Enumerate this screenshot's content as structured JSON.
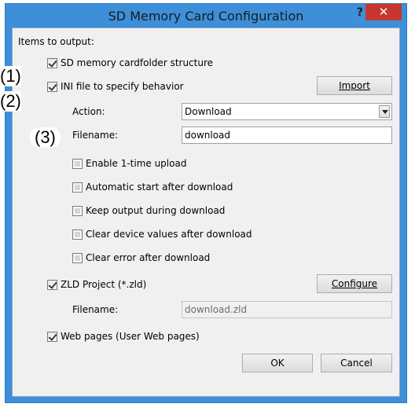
{
  "window": {
    "title": "SD Memory Card Configuration",
    "help": "?",
    "close": "✕"
  },
  "header": "Items to output:",
  "markers": {
    "m1": "(1)",
    "m2": "(2)",
    "m3": "(3)"
  },
  "items": {
    "sd_folder": {
      "label": "SD memory cardfolder structure",
      "checked": true
    },
    "ini_file": {
      "label": "INI file to specify behavior",
      "checked": true
    },
    "import_button": "Import",
    "action_label": "Action:",
    "action_value": "Download",
    "filename_label": "Filename:",
    "filename_value": "download",
    "options": [
      {
        "label": "Enable 1-time upload",
        "checked": false
      },
      {
        "label": "Automatic start after download",
        "checked": false
      },
      {
        "label": "Keep output during download",
        "checked": false
      },
      {
        "label": "Clear device values after download",
        "checked": false
      },
      {
        "label": "Clear error after download",
        "checked": false
      }
    ],
    "zld_project": {
      "label": "ZLD Project (*.zld)",
      "checked": true
    },
    "configure_button": "Configure",
    "zld_filename_label": "Filename:",
    "zld_filename_value": "download.zld",
    "web_pages": {
      "label": "Web pages (User Web pages)",
      "checked": true
    }
  },
  "footer": {
    "ok": "OK",
    "cancel": "Cancel"
  }
}
